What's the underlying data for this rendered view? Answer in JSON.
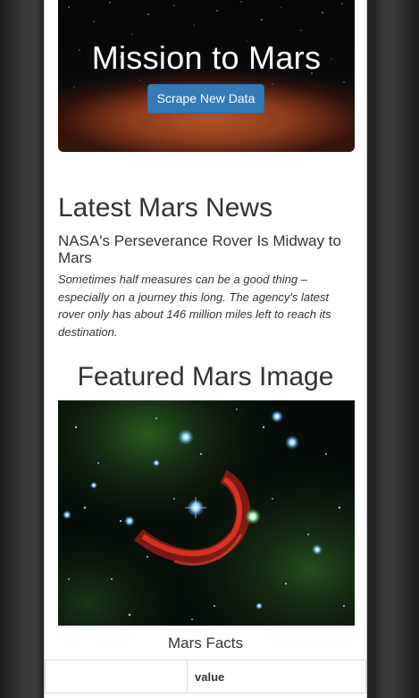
{
  "jumbotron": {
    "title": "Mission to Mars",
    "button_label": "Scrape New Data"
  },
  "news": {
    "heading": "Latest Mars News",
    "title": "NASA's Perseverance Rover Is Midway to Mars",
    "teaser": "Sometimes half measures can be a good thing – especially on a journey this long. The agency's latest rover only has about 146 million miles left to reach its destination."
  },
  "featured": {
    "heading": "Featured Mars Image"
  },
  "facts": {
    "caption": "Mars Facts",
    "columns": [
      "",
      "value"
    ]
  },
  "colors": {
    "button": "#337ab7",
    "page_background": "#ffffff",
    "outer_background": "#2b2b2b"
  }
}
